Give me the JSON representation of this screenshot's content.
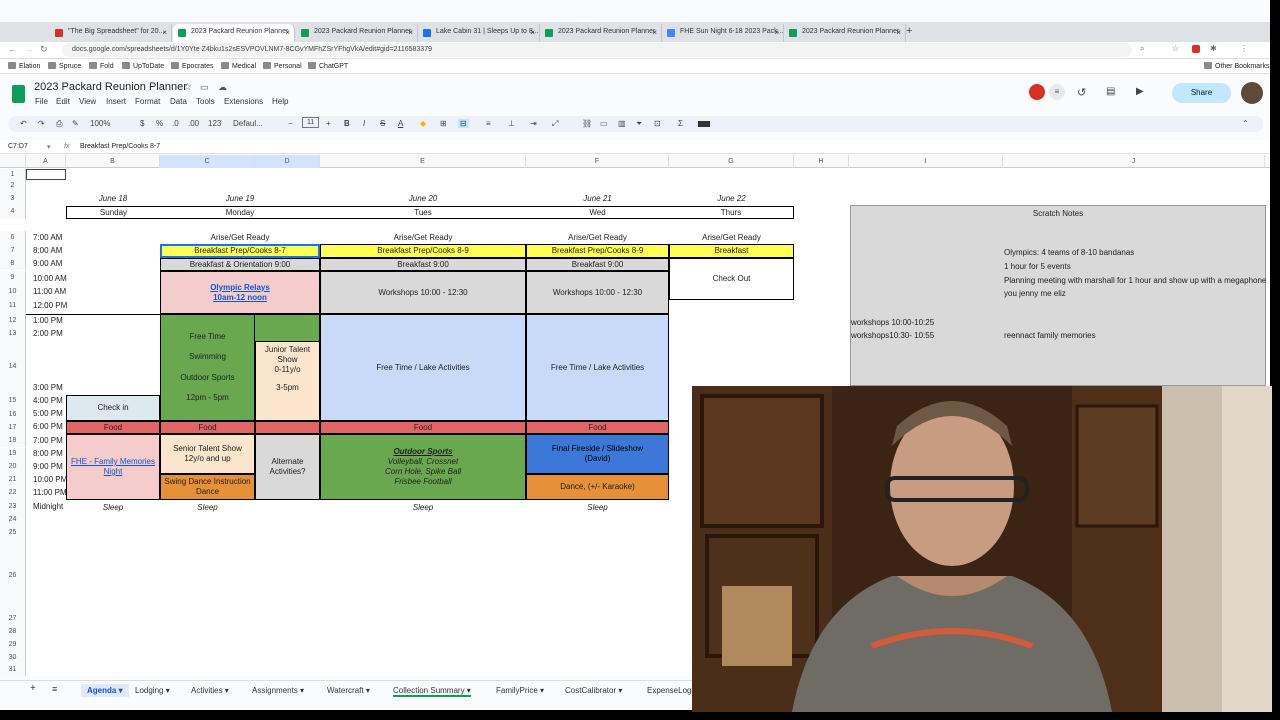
{
  "browser": {
    "tabs": [
      {
        "label": "\"The Big Spreadsheet\" for 20...",
        "color": "#d93025"
      },
      {
        "label": "2023 Packard Reunion Planner",
        "color": "#0f9d58"
      },
      {
        "label": "2023 Packard Reunion Planner",
        "color": "#0f9d58"
      },
      {
        "label": "Lake Cabin 31 | Sleeps Up to 8...",
        "color": "#1a73e8"
      },
      {
        "label": "2023 Packard Reunion Planner",
        "color": "#0f9d58"
      },
      {
        "label": "FHE Sun Night 6-18 2023 Pack...",
        "color": "#4285f4"
      },
      {
        "label": "2023 Packard Reunion Planner",
        "color": "#0f9d58"
      }
    ],
    "url": "docs.google.com/spreadsheets/d/1Y0Yte Z4bku1s2sESVPOVLNM7-8CGvYMFhZSrYFhgVkA/edit#gid=2116583379",
    "bookmarks": [
      "Elation",
      "Spruce",
      "Fold",
      "UpToDate",
      "Epocrates",
      "Medical",
      "Personal",
      "ChatGPT"
    ],
    "other_bookmarks": "Other Bookmarks"
  },
  "doc": {
    "title": "2023 Packard Reunion Planner",
    "menus": [
      "File",
      "Edit",
      "View",
      "Insert",
      "Format",
      "Data",
      "Tools",
      "Extensions",
      "Help"
    ],
    "share": "Share"
  },
  "toolbar": {
    "zoom": "100%",
    "currency": "$",
    "percent": "%",
    "dec_less": ".0",
    "dec_more": ".00",
    "numfmt": "123",
    "font": "Defaul...",
    "size": "11",
    "bold": "B",
    "italic": "I",
    "strike": "S",
    "underline": "A",
    "sum": "Σ"
  },
  "formula": {
    "cellref": "C7:D7",
    "fx": "fx",
    "content": "Breakfast Prep/Cooks  8-7"
  },
  "columns": [
    "A",
    "B",
    "C",
    "D",
    "E",
    "F",
    "G",
    "H",
    "I",
    "J"
  ],
  "rows": [
    "1",
    "2",
    "3",
    "4",
    "6",
    "7",
    "8",
    "9",
    "10",
    "11",
    "12",
    "13",
    "14",
    "15",
    "16",
    "17",
    "18",
    "19",
    "20",
    "21",
    "22",
    "23",
    "24",
    "25",
    "26",
    "27",
    "28",
    "29",
    "30",
    "31"
  ],
  "schedule": {
    "dates": [
      "June 18",
      "June 19",
      "June 20",
      "June 21",
      "June 22"
    ],
    "days": [
      "Sunday",
      "Monday",
      "Tues",
      "Wed",
      "Thurs"
    ],
    "times": [
      "7:00 AM",
      "8:00 AM",
      "9:00 AM",
      "10:00 AM",
      "11:00 AM",
      "12:00 PM",
      "1:00 PM",
      "2:00 PM",
      "3:00 PM",
      "4:00 PM",
      "5:00 PM",
      "6:00 PM",
      "7:00 PM",
      "8:00 PM",
      "9:00 PM",
      "10:00 PM",
      "11:00 PM",
      "Midnight"
    ],
    "arise": "Arise/Get Ready",
    "breakfast_prep_c": "Breakfast Prep/Cooks  8-7",
    "breakfast_prep_e": "Breakfast Prep/Cooks  8-9",
    "breakfast_prep_f": "Breakfast Prep/Cooks  8-9",
    "breakfast_g": "Breakfast",
    "breakfast_orientation": "Breakfast & Orientation 9:00",
    "breakfast_900": "Breakfast 9:00",
    "check_out": "Check Out",
    "olympic_1": "Olympic Relays",
    "olympic_2": "10am-12 noon",
    "workshops": "Workshops 10:00 - 12:30",
    "free_time_lines": [
      "Free Time",
      "Swimming",
      "Outdoor Sports",
      "12pm - 5pm"
    ],
    "junior_lines": [
      "Junior Talent Show",
      "0-11y/o",
      "3-5pm"
    ],
    "free_lake": "Free Time / Lake Activities",
    "check_in": "Check in",
    "food": "Food",
    "fhe": "FHE - Family Memories Night",
    "senior": "Senior Talent Show 12y/o and up",
    "swing": "Swing Dance Instruction Dance",
    "alternate": "Alternate Activities?",
    "outdoor_title": "Outdoor Sports",
    "outdoor_lines": [
      "Volleyball, Crossnet",
      "Corn Hole, Spike Ball",
      "Frisbee Football"
    ],
    "fireside": "Final Fireside / Slideshow (David)",
    "dance": "Dance, (+/- Karaoke)",
    "sleep": "Sleep"
  },
  "notes": {
    "title": "Scratch Notes",
    "line1": "Olympics: 4 teams of 8-10 bandanas",
    "line2": "1 hour for 5 events",
    "line3": "Planning meeting with marshall for 1 hour and show up with a megaphone",
    "line4": "you jenny me eliz",
    "ws1": "workshops 10:00-10:25",
    "ws2": "workshops10:30- 10:55",
    "reenact": "reennact family memories"
  },
  "sheets": [
    "Agenda",
    "Lodging",
    "Activities",
    "Assignments",
    "Watercraft",
    "Collection Summary",
    "FamilyPrice",
    "CostCalibrator",
    "ExpenseLog"
  ]
}
